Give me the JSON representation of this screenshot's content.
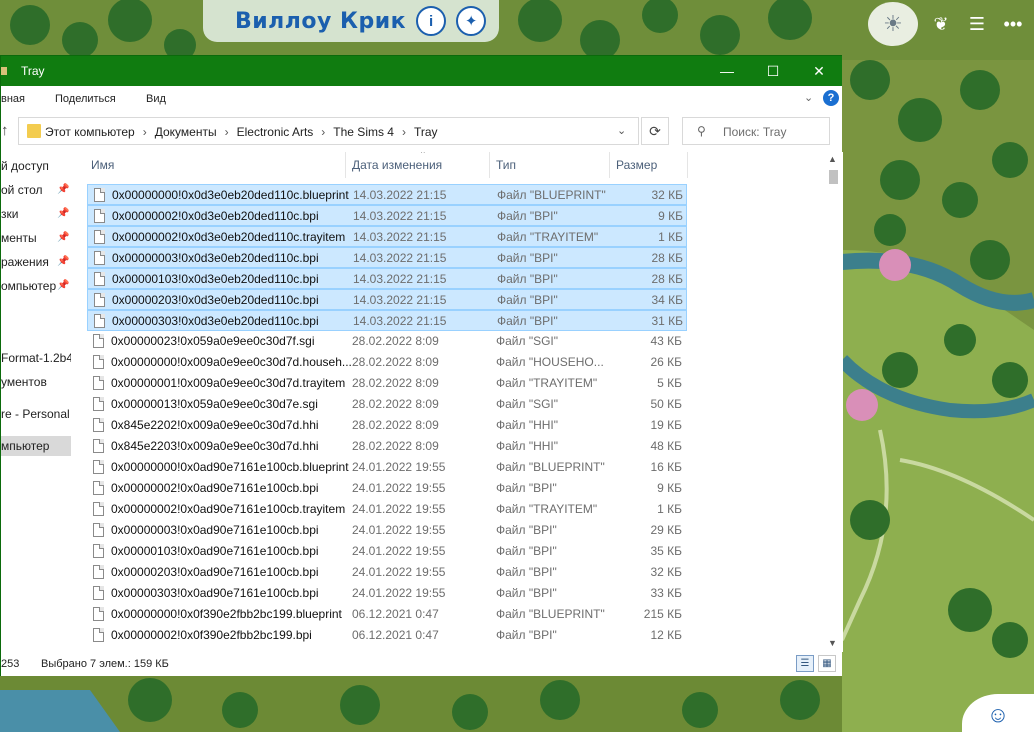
{
  "game": {
    "world_name": "Виллоу Крик"
  },
  "window": {
    "title": "Tray",
    "minimize": "—",
    "maximize": "☐",
    "close": "✕"
  },
  "ribbon": {
    "tabs": [
      "вная",
      "Поделиться",
      "Вид"
    ]
  },
  "address": {
    "crumbs": [
      "Этот компьютер",
      "Документы",
      "Electronic Arts",
      "The Sims 4",
      "Tray"
    ],
    "search_placeholder": "Поиск: Tray"
  },
  "nav": {
    "items": [
      {
        "label": "й доступ",
        "pinned": false
      },
      {
        "label": "ой стол",
        "pinned": true
      },
      {
        "label": "зки",
        "pinned": true
      },
      {
        "label": "менты",
        "pinned": true
      },
      {
        "label": "ражения",
        "pinned": true
      },
      {
        "label": "омпьютер",
        "pinned": true
      },
      {
        "label": "",
        "pinned": false
      },
      {
        "label": "Format-1.2b4",
        "pinned": false
      },
      {
        "label": "ументов",
        "pinned": false
      },
      {
        "label": "re - Personal",
        "pinned": false
      },
      {
        "label": "мпьютер",
        "pinned": false
      }
    ]
  },
  "columns": {
    "name": "Имя",
    "date": "Дата изменения",
    "type": "Тип",
    "size": "Размер"
  },
  "files": [
    {
      "name": "0x00000000!0x0d3e0eb20ded110c.blueprint",
      "date": "14.03.2022 21:15",
      "type": "Файл \"BLUEPRINT\"",
      "size": "32 КБ",
      "selected": true
    },
    {
      "name": "0x00000002!0x0d3e0eb20ded110c.bpi",
      "date": "14.03.2022 21:15",
      "type": "Файл \"BPI\"",
      "size": "9 КБ",
      "selected": true
    },
    {
      "name": "0x00000002!0x0d3e0eb20ded110c.trayitem",
      "date": "14.03.2022 21:15",
      "type": "Файл \"TRAYITEM\"",
      "size": "1 КБ",
      "selected": true
    },
    {
      "name": "0x00000003!0x0d3e0eb20ded110c.bpi",
      "date": "14.03.2022 21:15",
      "type": "Файл \"BPI\"",
      "size": "28 КБ",
      "selected": true
    },
    {
      "name": "0x00000103!0x0d3e0eb20ded110c.bpi",
      "date": "14.03.2022 21:15",
      "type": "Файл \"BPI\"",
      "size": "28 КБ",
      "selected": true
    },
    {
      "name": "0x00000203!0x0d3e0eb20ded110c.bpi",
      "date": "14.03.2022 21:15",
      "type": "Файл \"BPI\"",
      "size": "34 КБ",
      "selected": true
    },
    {
      "name": "0x00000303!0x0d3e0eb20ded110c.bpi",
      "date": "14.03.2022 21:15",
      "type": "Файл \"BPI\"",
      "size": "31 КБ",
      "selected": true
    },
    {
      "name": "0x00000023!0x059a0e9ee0c30d7f.sgi",
      "date": "28.02.2022 8:09",
      "type": "Файл \"SGI\"",
      "size": "43 КБ",
      "selected": false
    },
    {
      "name": "0x00000000!0x009a0e9ee0c30d7d.househ...",
      "date": "28.02.2022 8:09",
      "type": "Файл \"HOUSEHO...",
      "size": "26 КБ",
      "selected": false
    },
    {
      "name": "0x00000001!0x009a0e9ee0c30d7d.trayitem",
      "date": "28.02.2022 8:09",
      "type": "Файл \"TRAYITEM\"",
      "size": "5 КБ",
      "selected": false
    },
    {
      "name": "0x00000013!0x059a0e9ee0c30d7e.sgi",
      "date": "28.02.2022 8:09",
      "type": "Файл \"SGI\"",
      "size": "50 КБ",
      "selected": false
    },
    {
      "name": "0x845e2202!0x009a0e9ee0c30d7d.hhi",
      "date": "28.02.2022 8:09",
      "type": "Файл \"HHI\"",
      "size": "19 КБ",
      "selected": false
    },
    {
      "name": "0x845e2203!0x009a0e9ee0c30d7d.hhi",
      "date": "28.02.2022 8:09",
      "type": "Файл \"HHI\"",
      "size": "48 КБ",
      "selected": false
    },
    {
      "name": "0x00000000!0x0ad90e7161e100cb.blueprint",
      "date": "24.01.2022 19:55",
      "type": "Файл \"BLUEPRINT\"",
      "size": "16 КБ",
      "selected": false
    },
    {
      "name": "0x00000002!0x0ad90e7161e100cb.bpi",
      "date": "24.01.2022 19:55",
      "type": "Файл \"BPI\"",
      "size": "9 КБ",
      "selected": false
    },
    {
      "name": "0x00000002!0x0ad90e7161e100cb.trayitem",
      "date": "24.01.2022 19:55",
      "type": "Файл \"TRAYITEM\"",
      "size": "1 КБ",
      "selected": false
    },
    {
      "name": "0x00000003!0x0ad90e7161e100cb.bpi",
      "date": "24.01.2022 19:55",
      "type": "Файл \"BPI\"",
      "size": "29 КБ",
      "selected": false
    },
    {
      "name": "0x00000103!0x0ad90e7161e100cb.bpi",
      "date": "24.01.2022 19:55",
      "type": "Файл \"BPI\"",
      "size": "35 КБ",
      "selected": false
    },
    {
      "name": "0x00000203!0x0ad90e7161e100cb.bpi",
      "date": "24.01.2022 19:55",
      "type": "Файл \"BPI\"",
      "size": "32 КБ",
      "selected": false
    },
    {
      "name": "0x00000303!0x0ad90e7161e100cb.bpi",
      "date": "24.01.2022 19:55",
      "type": "Файл \"BPI\"",
      "size": "33 КБ",
      "selected": false
    },
    {
      "name": "0x00000000!0x0f390e2fbb2bc199.blueprint",
      "date": "06.12.2021 0:47",
      "type": "Файл \"BLUEPRINT\"",
      "size": "215 КБ",
      "selected": false
    },
    {
      "name": "0x00000002!0x0f390e2fbb2bc199.bpi",
      "date": "06.12.2021 0:47",
      "type": "Файл \"BPI\"",
      "size": "12 КБ",
      "selected": false
    }
  ],
  "status": {
    "count": "253",
    "selection": "Выбрано 7 элем.: 159 КБ"
  },
  "colors": {
    "titlebar": "#107c10",
    "selection": "#cce8ff",
    "accent": "#1b5fae"
  },
  "icons": {
    "game_info": "info-icon",
    "game_share": "footprint-icon",
    "hud_tip": "lightbulb-icon",
    "hud_relations": "relationship-icon",
    "hud_menu": "list-icon",
    "hud_more": "ellipsis-icon"
  }
}
